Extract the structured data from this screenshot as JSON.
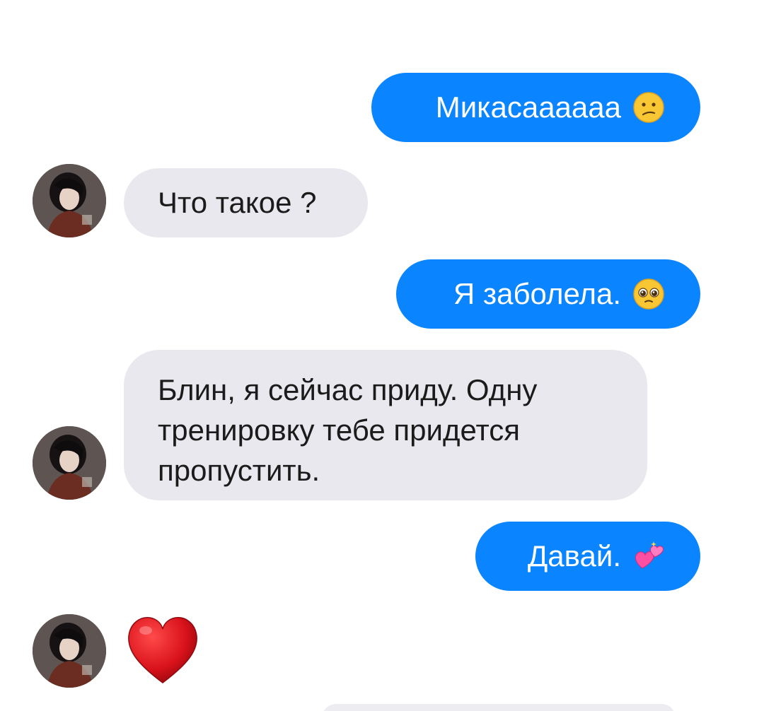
{
  "messages": [
    {
      "direction": "outgoing",
      "text": "Микасаааааа",
      "emoji": "confused-face-icon"
    },
    {
      "direction": "incoming",
      "text": "Что такое ?"
    },
    {
      "direction": "outgoing",
      "text": "Я заболела.",
      "emoji": "pleading-face-icon"
    },
    {
      "direction": "incoming",
      "lines": [
        "Блин, я сейчас приду. Одну",
        "тренировку тебе придется",
        "пропустить."
      ]
    },
    {
      "direction": "outgoing",
      "text": "Давай.",
      "emoji": "two-hearts-icon"
    },
    {
      "direction": "incoming",
      "emoji": "red-heart-icon"
    }
  ],
  "colors": {
    "outgoing_bubble": "#0a84ff",
    "incoming_bubble": "#e9e8ee",
    "outgoing_text": "#ffffff",
    "incoming_text": "#1b1b1b",
    "background": "#ffffff"
  }
}
